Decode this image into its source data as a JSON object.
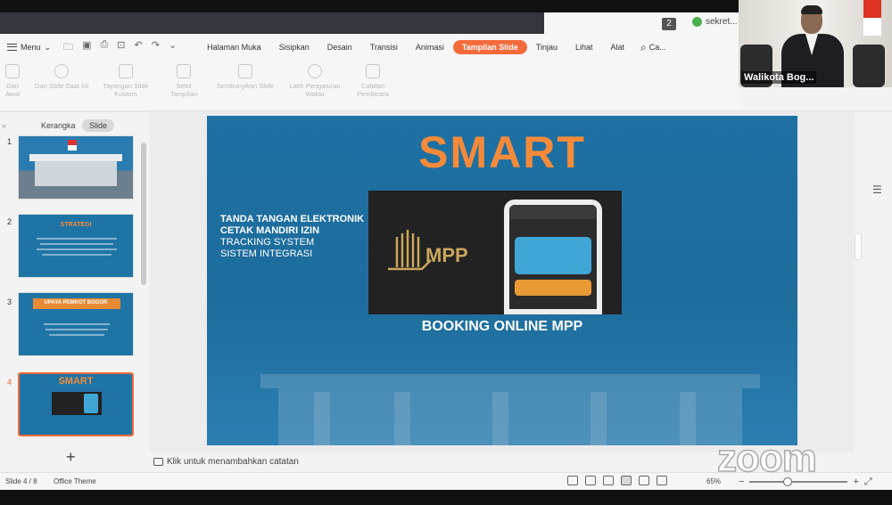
{
  "titlebar": {
    "notif_count": "2",
    "user_label": "sekret..."
  },
  "menu": {
    "menu_label": "Menu",
    "tabs": [
      "Halaman Muka",
      "Sisipkan",
      "Desain",
      "Transisi",
      "Animasi",
      "Tampilan Slide",
      "Tinjau",
      "Lihat",
      "Alat"
    ],
    "active_tab": "Tampilan Slide",
    "search_label": "Ca..."
  },
  "ribbon": {
    "items": [
      "Dari Awal",
      "Dari Slide Saat Ini",
      "Tayangan Slide Kustom",
      "Setel Tampilan",
      "Sembunyikan Slide",
      "Latih Pengaturan Waktu",
      "Catatan Pembicara"
    ]
  },
  "video": {
    "participant_name": "Walikota Bog..."
  },
  "leftpane": {
    "tabs": [
      "Kerangka",
      "Slide"
    ],
    "active_tab": "Slide",
    "thumbnails": [
      {
        "num": "1",
        "title": ""
      },
      {
        "num": "2",
        "title": "STRATEGI"
      },
      {
        "num": "3",
        "title": "UPAYA PEMKOT BOGOR"
      },
      {
        "num": "4",
        "title": "SMART"
      }
    ],
    "add_label": "+"
  },
  "slide": {
    "title": "SMART",
    "bullets_bold": [
      "TANDA TANGAN ELEKTRONIK",
      "CETAK MANDIRI IZIN"
    ],
    "bullets_normal": [
      "TRACKING SYSTEM",
      "SISTEM INTEGRASI"
    ],
    "logo_text": "MPP",
    "caption": "BOOKING ONLINE MPP"
  },
  "notes": {
    "placeholder": "Klik untuk menambahkan catatan"
  },
  "status": {
    "slide_info": "Slide 4 / 8",
    "theme": "Office Theme",
    "zoom": "65%"
  },
  "overlay": {
    "zoom_logo": "zoom"
  }
}
